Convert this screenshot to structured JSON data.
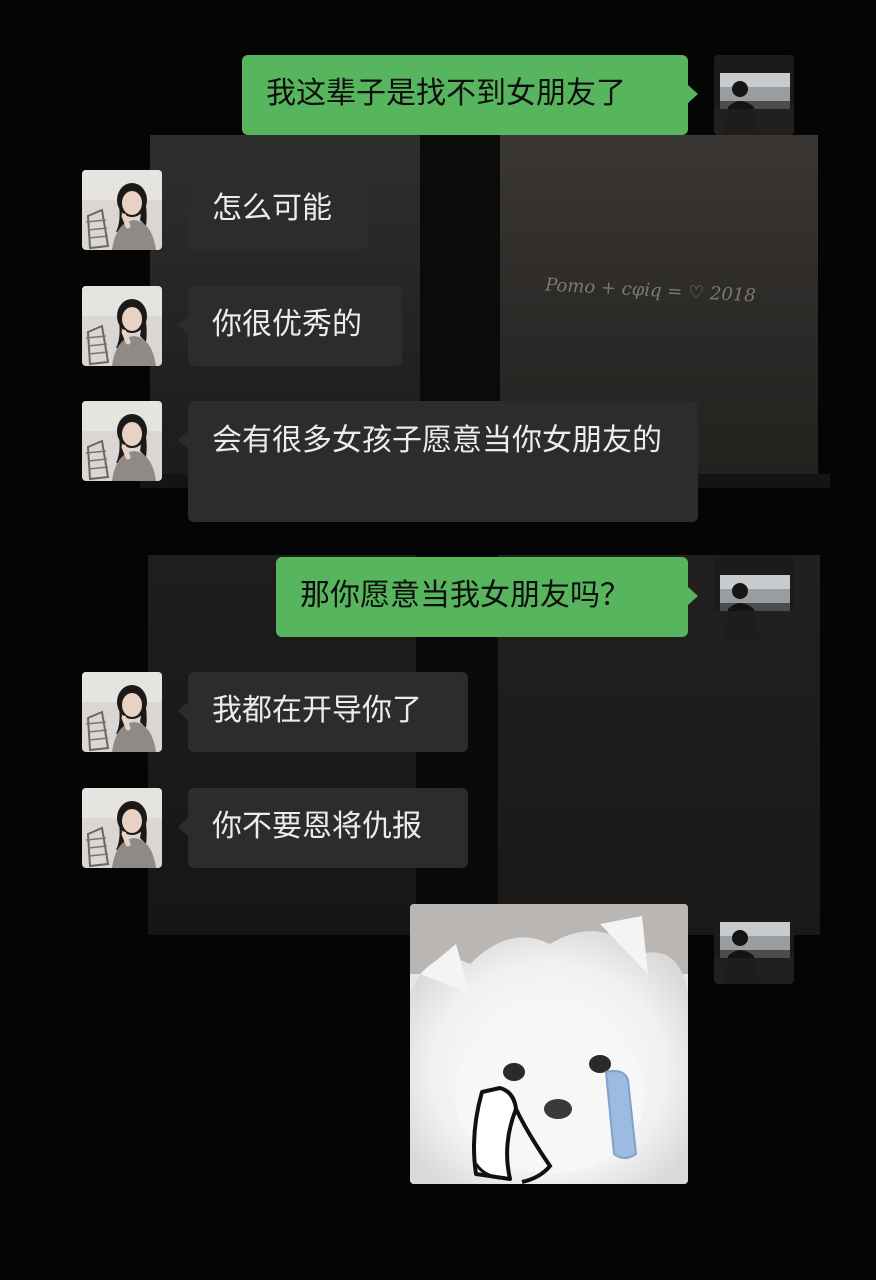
{
  "background": {
    "wall_scribble": "Pomo + cφiq = ♡ 2018"
  },
  "colors": {
    "sent_bubble": "#57b55e",
    "received_bubble": "#2c2c2c",
    "background": "#050505"
  },
  "messages": [
    {
      "side": "right",
      "text": "我这辈子是找不到女朋友了"
    },
    {
      "side": "left",
      "text": "怎么可能"
    },
    {
      "side": "left",
      "text": "你很优秀的"
    },
    {
      "side": "left",
      "text": "会有很多女孩子愿意当你女朋友的"
    },
    {
      "side": "right",
      "text": "那你愿意当我女朋友吗？"
    },
    {
      "side": "left",
      "text": "我都在开导你了"
    },
    {
      "side": "left",
      "text": "你不要恩将仇报"
    },
    {
      "side": "right",
      "sticker": "crying-white-dog-with-tissue"
    }
  ]
}
